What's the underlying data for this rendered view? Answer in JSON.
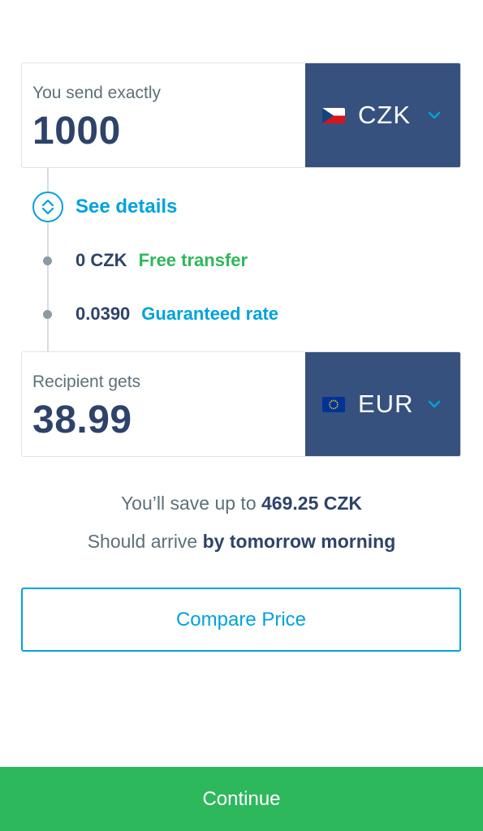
{
  "send": {
    "label": "You send exactly",
    "amount": "1000",
    "currency": "CZK",
    "flag_icon": "czech-flag-icon"
  },
  "details": {
    "toggle_label": "See details",
    "toggle_icon": "expand-collapse-icon",
    "fee_amount": "0 CZK",
    "fee_label": "Free transfer",
    "rate_value": "0.0390",
    "rate_label": "Guaranteed rate"
  },
  "receive": {
    "label": "Recipient gets",
    "amount": "38.99",
    "currency": "EUR",
    "flag_icon": "eu-flag-icon"
  },
  "summary": {
    "save_prefix": "You’ll save up to ",
    "save_amount": "469.25 CZK",
    "arrive_prefix": "Should arrive ",
    "arrive_time": "by tomorrow morning"
  },
  "buttons": {
    "compare": "Compare Price",
    "continue": "Continue"
  },
  "colors": {
    "accent_blue": "#00a2dd",
    "navy": "#2e4369",
    "currency_bg": "#37517e",
    "green": "#2eb85c"
  }
}
